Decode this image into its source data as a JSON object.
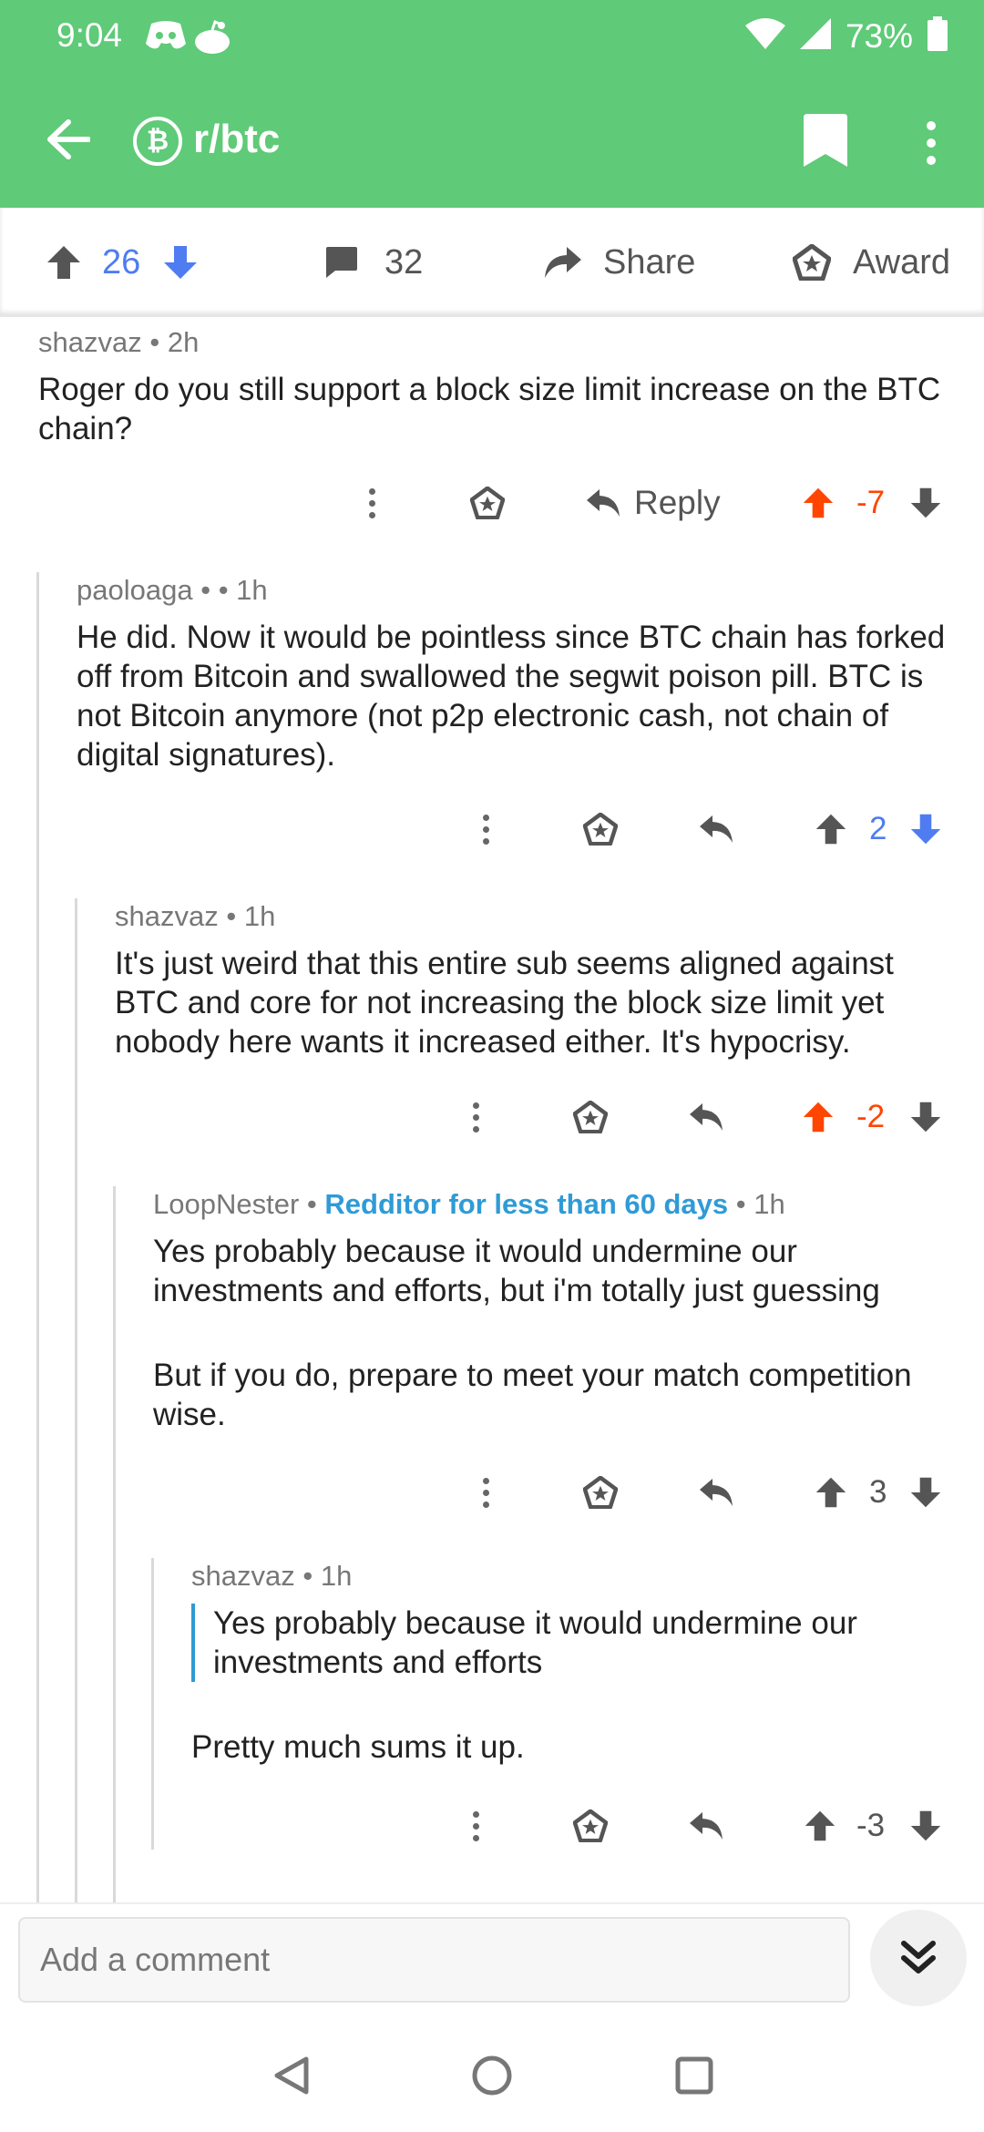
{
  "status_bar": {
    "time": "9:04",
    "battery": "73%"
  },
  "app_bar": {
    "subreddit": "r/btc",
    "sub_icon_glyph": "₿"
  },
  "post_actions": {
    "votes": "26",
    "comments": "32",
    "share": "Share",
    "award": "Award"
  },
  "comments": [
    {
      "author": "shazvaz",
      "sep": "•",
      "age": "2h",
      "body": [
        "Roger do you still support a block size limit increase on the BTC chain?"
      ],
      "reply_label": "Reply",
      "score": "-7",
      "vote_state": "upvoted"
    },
    {
      "author": "paoloaga",
      "sep": "•",
      "sep2": "•",
      "age": "1h",
      "body": [
        "He did. Now it would be pointless since BTC chain has forked off from Bitcoin and swallowed the segwit poison pill. BTC is not Bitcoin anymore (not p2p electronic cash, not chain of digital signatures)."
      ],
      "score": "2",
      "vote_state": "downvoted"
    },
    {
      "author": "shazvaz",
      "sep": "•",
      "age": "1h",
      "body": [
        "It's just weird that this entire sub seems aligned against BTC and core for not increasing the block size limit yet nobody here wants it increased either. It's hypocrisy."
      ],
      "score": "-2",
      "vote_state": "upvoted"
    },
    {
      "author": "LoopNester",
      "sep": "•",
      "flair": "Redditor for less than 60 days",
      "sep2": "•",
      "age": "1h",
      "body": [
        "Yes probably because it would undermine our investments and efforts, but i'm totally just guessing",
        "But if you do, prepare to meet your match competition wise."
      ],
      "score": "3",
      "vote_state": "none"
    },
    {
      "author": "shazvaz",
      "sep": "•",
      "age": "1h",
      "quote": "Yes probably because it would undermine our investments and efforts",
      "body": [
        "Pretty much sums it up."
      ],
      "score": "-3",
      "vote_state": "none"
    }
  ],
  "composer": {
    "placeholder": "Add a comment"
  },
  "colors": {
    "accent": "#5fca78",
    "upvote": "#ff4500",
    "downvote": "#4f7cf0",
    "flair": "#2f9bd6"
  },
  "icons": [
    "back-arrow-icon",
    "bitcoin-icon",
    "bookmark-icon",
    "more-vert-icon",
    "upvote-icon",
    "downvote-icon",
    "comment-icon",
    "share-icon",
    "award-icon",
    "reply-icon",
    "double-chevron-down-icon"
  ]
}
